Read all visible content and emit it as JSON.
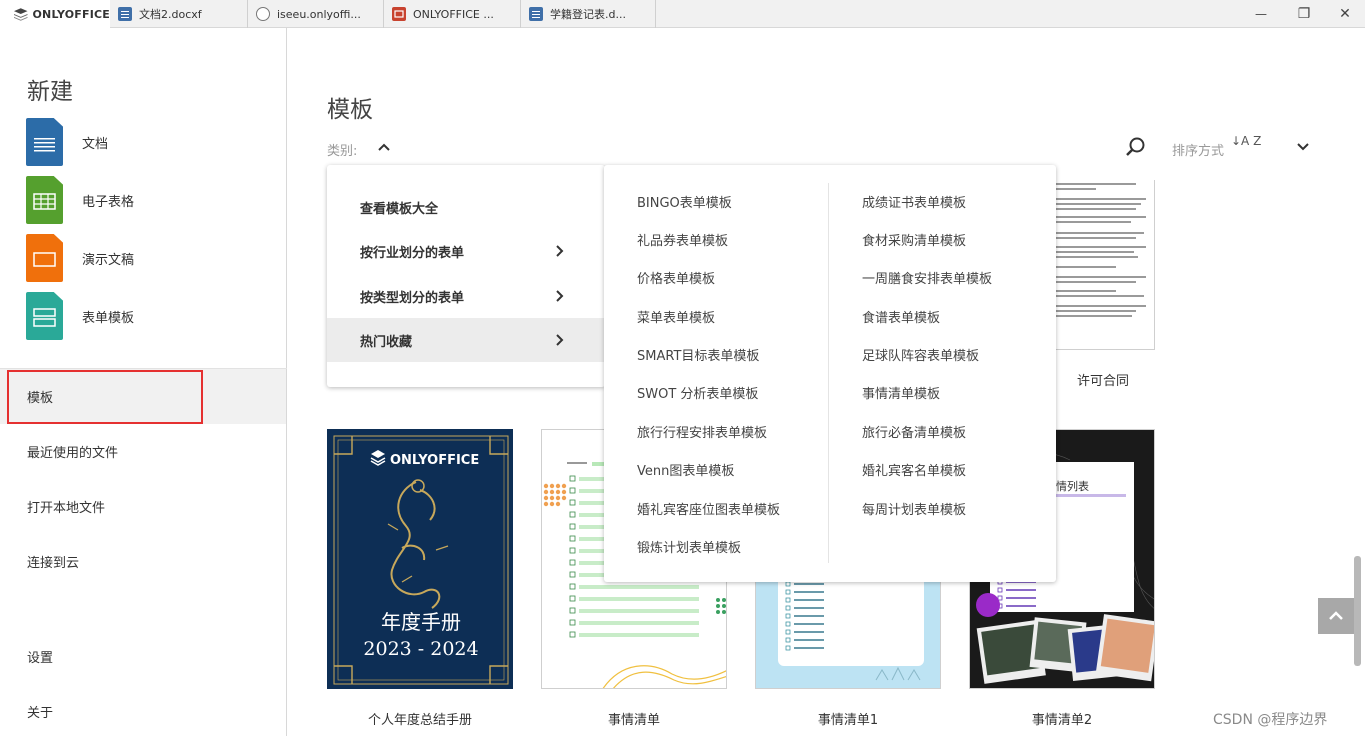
{
  "titlebar": {
    "brand": "ONLYOFFICE",
    "tabs": [
      {
        "label": "文档2.docxf",
        "icon": "document-icon",
        "color": "#3f6fa8"
      },
      {
        "label": "iseeu.onlyoffi...",
        "icon": "globe-icon",
        "color": "#777777"
      },
      {
        "label": "ONLYOFFICE ...",
        "icon": "presentation-icon",
        "color": "#c8432f"
      },
      {
        "label": "学籍登记表.d...",
        "icon": "document-icon",
        "color": "#3f6fa8"
      }
    ],
    "controls": {
      "minimize": "—",
      "restore": "❐",
      "close": "✕"
    }
  },
  "sidebar": {
    "create_title": "新建",
    "create_items": [
      {
        "label": "文档",
        "icon": "document-icon",
        "color": "#2c6ca8"
      },
      {
        "label": "电子表格",
        "icon": "spreadsheet-icon",
        "color": "#55a02e"
      },
      {
        "label": "演示文稿",
        "icon": "presentation-icon",
        "color": "#f0700c"
      },
      {
        "label": "表单模板",
        "icon": "form-template-icon",
        "color": "#2aa998"
      }
    ],
    "nav": {
      "templates": "模板",
      "recent": "最近使用的文件",
      "open_local": "打开本地文件",
      "connect_cloud": "连接到云",
      "settings": "设置",
      "about": "关于"
    }
  },
  "main": {
    "title": "模板",
    "category_label": "类别:",
    "sort_label": "排序方式",
    "sort_icon_glyph": "↓A Z",
    "cards": [
      {
        "title": "个人年度总结手册",
        "brand": "ONLYOFFICE",
        "heading": "年度手册",
        "years": "2023 - 2024"
      },
      {
        "title": "事情清单"
      },
      {
        "title": "事情清单1"
      },
      {
        "title": "事情清单2",
        "heading": "情列表"
      }
    ],
    "partial_card_title": "许可合同",
    "dropdown": {
      "items": [
        "查看模板大全",
        "按行业划分的表单",
        "按类型划分的表单",
        "热门收藏"
      ]
    },
    "submenu": {
      "col1": [
        "BINGO表单模板",
        "礼品券表单模板",
        "价格表单模板",
        "菜单表单模板",
        "SMART目标表单模板",
        "SWOT 分析表单模板",
        "旅行行程安排表单模板",
        "Venn图表单模板",
        "婚礼宾客座位图表单模板",
        "锻炼计划表单模板"
      ],
      "col2": [
        "成绩证书表单模板",
        "食材采购清单模板",
        "一周膳食安排表单模板",
        "食谱表单模板",
        "足球队阵容表单模板",
        "事情清单模板",
        "旅行必备清单模板",
        "婚礼宾客名单模板",
        "每周计划表单模板"
      ]
    }
  },
  "watermark": "CSDN @程序边界"
}
